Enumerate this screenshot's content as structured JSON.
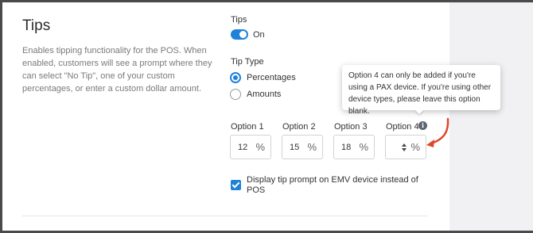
{
  "section": {
    "title": "Tips",
    "description": "Enables tipping functionality for the POS. When enabled, customers will see a prompt where they can select \"No Tip\", one of your custom percentages, or enter a custom dollar amount."
  },
  "tips_toggle": {
    "label": "Tips",
    "state_label": "On",
    "enabled": true
  },
  "tip_type": {
    "label": "Tip Type",
    "options": [
      {
        "label": "Percentages",
        "selected": true
      },
      {
        "label": "Amounts",
        "selected": false
      }
    ]
  },
  "tip_options": [
    {
      "label": "Option 1",
      "value": "12",
      "unit": "%"
    },
    {
      "label": "Option 2",
      "value": "15",
      "unit": "%"
    },
    {
      "label": "Option 3",
      "value": "18",
      "unit": "%"
    },
    {
      "label": "Option 4",
      "value": "",
      "unit": "%"
    }
  ],
  "tooltip": {
    "text": "Option 4 can only be added if you're using a PAX device. If you're using other device types, please leave this option blank."
  },
  "emv_prompt": {
    "label": "Display tip prompt on EMV device instead of POS",
    "checked": true
  },
  "colors": {
    "accent": "#1f82d9",
    "annotation_arrow": "#e0452b",
    "side_panel": "#f1f1f3"
  },
  "icons": [
    "info-icon",
    "spinner-icon",
    "check-icon",
    "annotation-arrow-icon"
  ]
}
